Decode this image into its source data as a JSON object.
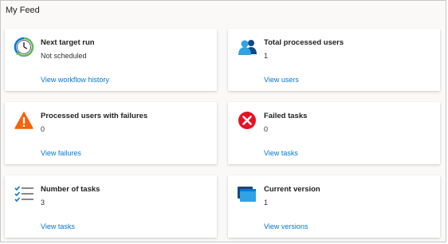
{
  "feed": {
    "title": "My Feed"
  },
  "cards": [
    {
      "title": "Next target run",
      "value": "Not scheduled",
      "link": "View workflow history",
      "icon": "clock-icon"
    },
    {
      "title": "Total processed users",
      "value": "1",
      "link": "View users",
      "icon": "users-icon"
    },
    {
      "title": "Processed users with failures",
      "value": "0",
      "link": "View failures",
      "icon": "warning-icon"
    },
    {
      "title": "Failed tasks",
      "value": "0",
      "link": "View tasks",
      "icon": "error-icon"
    },
    {
      "title": "Number of tasks",
      "value": "3",
      "link": "View tasks",
      "icon": "checklist-icon"
    },
    {
      "title": "Current version",
      "value": "1",
      "link": "View versions",
      "icon": "versions-icon"
    }
  ],
  "colors": {
    "link": "#0078d4",
    "warning": "#f7630c",
    "error": "#e81123",
    "accent_blue": "#0078d4",
    "accent_green": "#5db85c"
  }
}
